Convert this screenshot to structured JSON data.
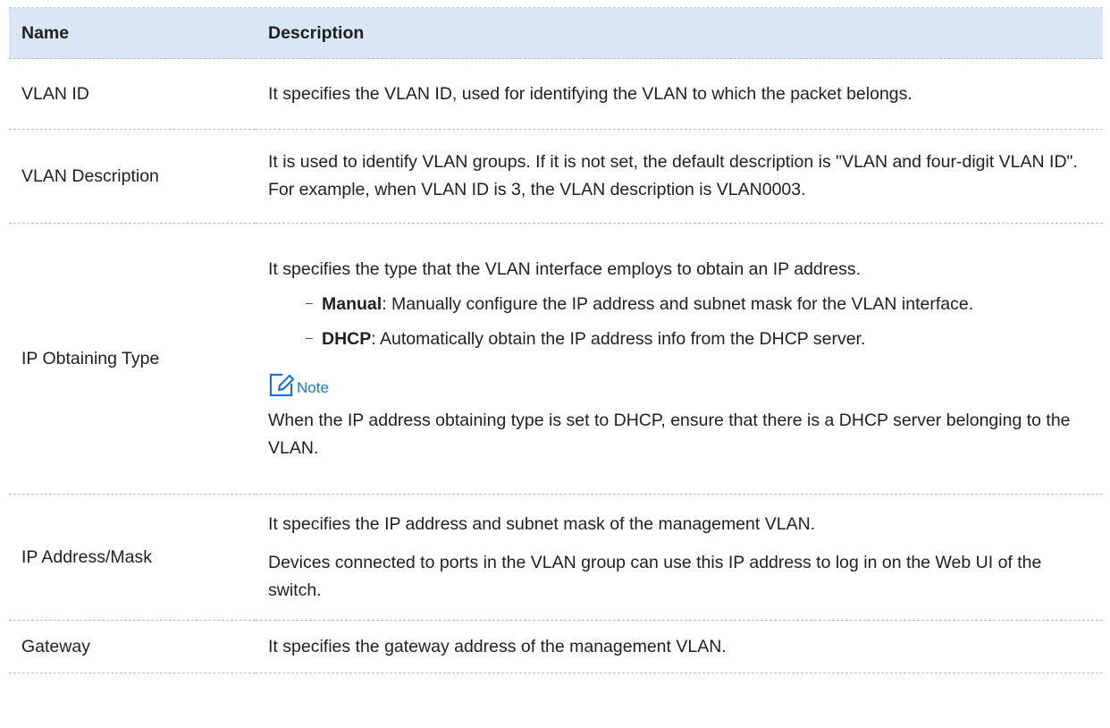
{
  "table": {
    "headers": {
      "name": "Name",
      "description": "Description"
    },
    "rows": [
      {
        "name": "VLAN ID",
        "desc": "It specifies the VLAN ID, used for identifying the VLAN to which the packet belongs."
      },
      {
        "name": "VLAN Description",
        "desc": "It is used to identify VLAN groups. If it is not set, the default description is \"VLAN and four-digit VLAN ID\". For example, when VLAN ID is 3, the VLAN description is VLAN0003."
      },
      {
        "name": "IP Obtaining Type",
        "intro": "It specifies the type that the VLAN interface employs to obtain an IP address.",
        "options": [
          {
            "term": "Manual",
            "text": ": Manually configure the IP address and subnet mask for the VLAN interface."
          },
          {
            "term": "DHCP",
            "text": ": Automatically obtain the IP address info from the DHCP server."
          }
        ],
        "note_label": "Note",
        "note_text": "When the IP address obtaining type is set to DHCP, ensure that there is a DHCP server belonging to the VLAN."
      },
      {
        "name": "IP Address/Mask",
        "desc_1": "It specifies the IP address and subnet mask of the management VLAN.",
        "desc_2": "Devices connected to ports in the VLAN group can use this IP address to log in on the Web UI of the switch."
      },
      {
        "name": "Gateway",
        "desc": "It specifies the gateway address of the management VLAN."
      }
    ]
  },
  "icons": {
    "note": "note-edit-icon",
    "bullet": "dash-bullet"
  },
  "colors": {
    "header_bg": "#dbe6f4",
    "note_accent": "#1e73d9",
    "divider": "#bdbdbd"
  }
}
